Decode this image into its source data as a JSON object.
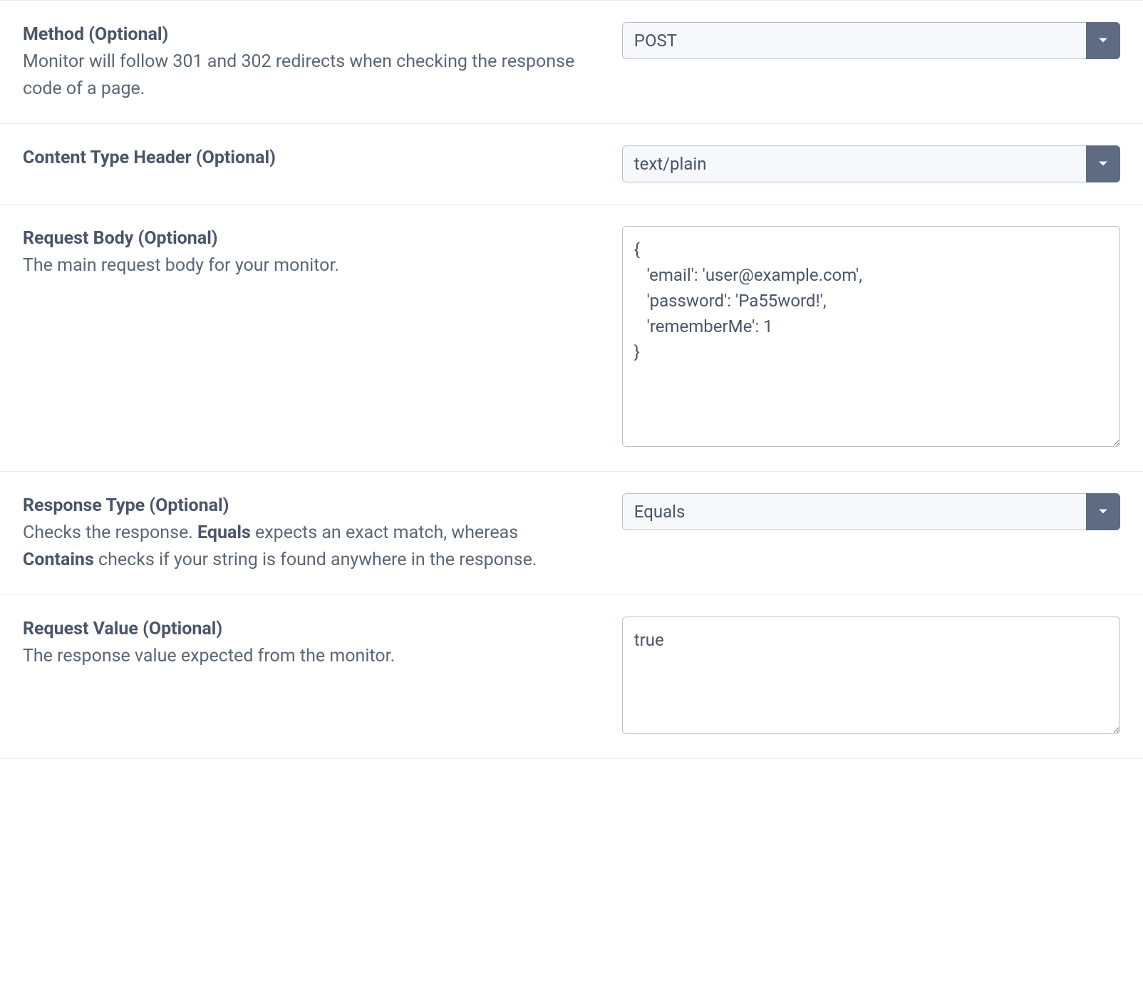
{
  "method": {
    "label": "Method (Optional)",
    "desc": "Monitor will follow 301 and 302 redirects when checking the response code of a page.",
    "value": "POST"
  },
  "content_type": {
    "label": "Content Type Header (Optional)",
    "value": "text/plain"
  },
  "request_body": {
    "label": "Request Body (Optional)",
    "desc": "The main request body for your monitor.",
    "value": "{\n   'email': 'user@example.com',\n   'password': 'Pa55word!',\n   'rememberMe': 1\n}"
  },
  "response_type": {
    "label": "Response Type (Optional)",
    "desc_pre": "Checks the response. ",
    "desc_bold1": "Equals",
    "desc_mid": " expects an exact match, whereas ",
    "desc_bold2": "Contains",
    "desc_post": " checks if your string is found anywhere in the response.",
    "value": "Equals"
  },
  "request_value": {
    "label": "Request Value (Optional)",
    "desc": "The response value expected from the monitor.",
    "value": "true"
  }
}
